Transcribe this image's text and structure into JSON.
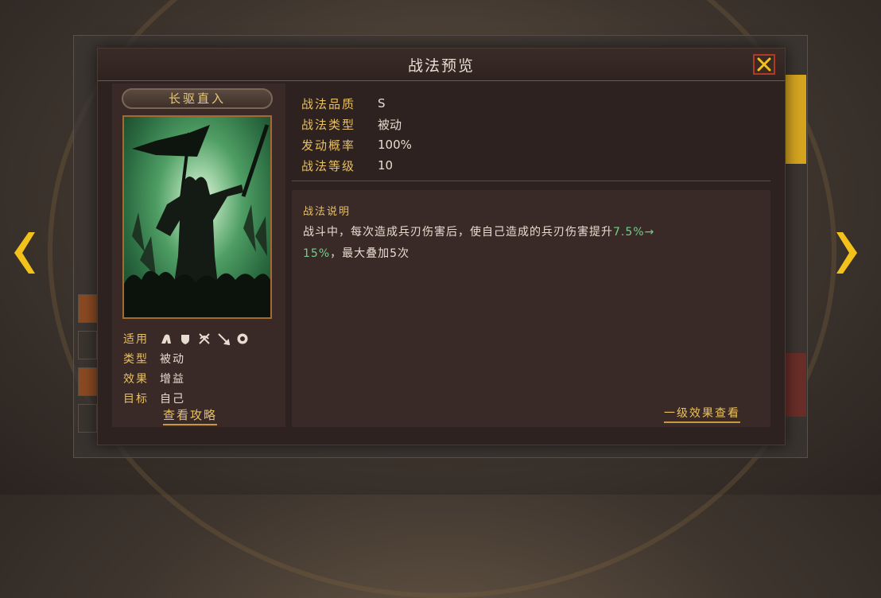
{
  "dialog": {
    "title": "战法预览"
  },
  "skill": {
    "name": "长驱直入",
    "attributes": [
      {
        "label": "适用",
        "value": ""
      },
      {
        "label": "类型",
        "value": "被动"
      },
      {
        "label": "效果",
        "value": "增益"
      },
      {
        "label": "目标",
        "value": "自己"
      }
    ],
    "troop_icons": [
      "cavalry-icon",
      "shield-icon",
      "bow-icon",
      "spear-icon",
      "siege-icon"
    ],
    "guide_link": "查看攻略"
  },
  "info": {
    "quality_label": "战法品质",
    "quality_value": "S",
    "type_label": "战法类型",
    "type_value": "被动",
    "rate_label": "发动概率",
    "rate_value": "100%",
    "level_label": "战法等级",
    "level_value": "10"
  },
  "description": {
    "title": "战法说明",
    "text_1": "战斗中，每次造成兵刃伤害后，使自己造成的兵刃伤害提升",
    "highlight_1": "7.5%→",
    "highlight_2": "15%",
    "text_2": "，最大叠加5次",
    "effect_link": "一级效果查看"
  },
  "colors": {
    "accent": "#e8c060",
    "highlight": "#6fd08a",
    "close_border": "#b03a2a",
    "arrow": "#f2c21a"
  },
  "icons": {
    "close": "close-icon",
    "prev": "chevron-left-icon",
    "next": "chevron-right-icon"
  }
}
